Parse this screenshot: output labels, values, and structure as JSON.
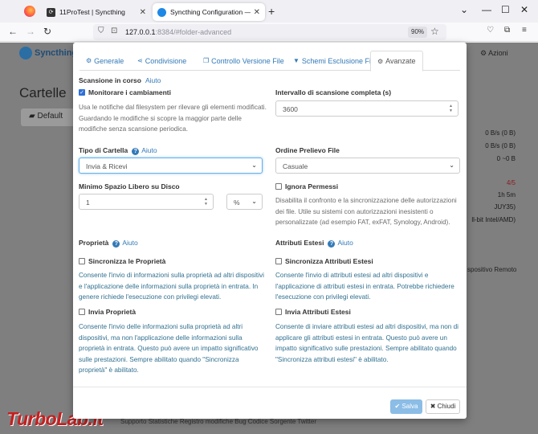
{
  "browser": {
    "tabs": [
      {
        "title": "11ProTest | Syncthing",
        "favicon": "syncthing-dark"
      },
      {
        "title": "Syncthing Configuration — Syn",
        "favicon": "syncthing"
      }
    ],
    "url_host": "127.0.0.1",
    "url_rest": ":8384/#folder-advanced",
    "zoom": "90%"
  },
  "app": {
    "brand": "Syncthing",
    "actions_label": "Azioni",
    "page_title": "Cartelle",
    "folder_name": "Default",
    "right_fragments": [
      "0 B/s (0 B)",
      "0 B/s (0 B)",
      "0 ~0 B",
      "4/5",
      "1h 5m",
      "JUY35)",
      "ll-bit Intel/AMD)"
    ],
    "remote_button": "spositivo Remoto",
    "footer_links": "Supporto   Statistiche   Registro modifiche   Bug   Codice Sorgente   Twitter",
    "watermark": "TurboLab.it"
  },
  "modal": {
    "tabs": [
      {
        "label": "Generale",
        "icon": "gear-icon"
      },
      {
        "label": "Condivisione",
        "icon": "share-icon"
      },
      {
        "label": "Controllo Versione File",
        "icon": "copy-icon"
      },
      {
        "label": "Schemi Esclusione File",
        "icon": "filter-icon"
      },
      {
        "label": "Avanzate",
        "icon": "cogs-icon"
      }
    ],
    "help_label": "Aiuto",
    "scan": {
      "title": "Scansione in corso",
      "watch_label": "Monitorare i cambiamenti",
      "watch_checked": true,
      "watch_desc": "Usa le notifiche dal filesystem per rilevare gli elementi modificati. Guardando le modifiche si scopre la maggior parte delle modifiche senza scansione periodica."
    },
    "rescan": {
      "title": "Intervallo di scansione completa (s)",
      "value": "3600"
    },
    "folder_type": {
      "title": "Tipo di Cartella",
      "value": "Invia & Ricevi"
    },
    "pull_order": {
      "title": "Ordine Prelievo File",
      "value": "Casuale"
    },
    "min_disk": {
      "title": "Minimo Spazio Libero su Disco",
      "value": "1",
      "unit": "%"
    },
    "ignore_perms": {
      "label": "Ignora Permessi",
      "checked": false,
      "desc": "Disabilita il confronto e la sincronizzazione delle autorizzazioni dei file. Utile su sistemi con autorizzazioni inesistenti o personalizzate (ad esempio FAT, exFAT, Synology, Android)."
    },
    "ownership": {
      "title": "Proprietà",
      "sync_label": "Sincronizza le Proprietà",
      "sync_desc": "Consente l'invio di informazioni sulla proprietà ad altri dispositivi e l'applicazione delle informazioni sulla proprietà in entrata. In genere richiede l'esecuzione con privilegi elevati.",
      "send_label": "Invia Proprietà",
      "send_desc": "Consente l'invio delle informazioni sulla proprietà ad altri dispositivi, ma non l'applicazione delle informazioni sulla proprietà in entrata. Questo può avere un impatto significativo sulle prestazioni. Sempre abilitato quando \"Sincronizza proprietà\" è abilitato."
    },
    "xattrs": {
      "title": "Attributi Estesi",
      "sync_label": "Sincronizza Attributi Estesi",
      "sync_desc": "Consente l'invio di attributi estesi ad altri dispositivi e l'applicazione di attributi estesi in entrata. Potrebbe richiedere l'esecuzione con privilegi elevati.",
      "send_label": "Invia Attributi Estesi",
      "send_desc": "Consente di inviare attributi estesi ad altri dispositivi, ma non di applicare gli attributi estesi in entrata. Questo può avere un impatto significativo sulle prestazioni. Sempre abilitato quando \"Sincronizza attributi estesi\" è abilitato."
    },
    "save_label": "Salva",
    "close_label": "Chiudi"
  }
}
